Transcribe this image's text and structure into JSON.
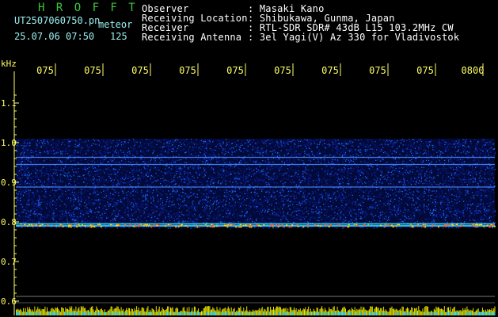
{
  "header": {
    "brand": "H R O F F T",
    "file_name": "UT2507060750.pn",
    "file_suffix": "meteor",
    "date_time": "25.07.06 07:50",
    "count": "125"
  },
  "info": {
    "labels": [
      "Observer",
      "Receiving Location",
      "Receiver",
      "Receiving Antenna"
    ],
    "values": [
      ": Masaki Kano",
      ": Shibukawa, Gunma, Japan",
      ": RTL-SDR SDR# 43dB L15 103.2MHz CW",
      ": 3el Yagi(V) Az 330 for Vladivostok"
    ]
  },
  "axis": {
    "unit": "kHz",
    "y_ticks": [
      "1.1",
      "1.0",
      "0.9",
      "0.8",
      "0.7",
      "0.6"
    ],
    "y_values": [
      1.1,
      1.0,
      0.9,
      0.8,
      0.7,
      0.6
    ],
    "y_range": [
      0.58,
      1.14
    ],
    "x_ticks": [
      "075",
      "075",
      "075",
      "075",
      "075",
      "075",
      "075",
      "075",
      "075",
      "0800"
    ]
  },
  "spectrogram": {
    "band_top_khz": 1.01,
    "band_bottom_khz": 0.785,
    "strong_lines_khz": [
      0.963,
      0.945,
      0.888,
      0.795,
      0.79
    ],
    "baseline_khz": 0.612,
    "colors": {
      "background": "#000000",
      "noise": "#0a1a8c",
      "signal": "#1e6bff",
      "hot": "#ffd800",
      "axis_text": "#ffff66",
      "cyan": "#3fe0f0"
    }
  }
}
